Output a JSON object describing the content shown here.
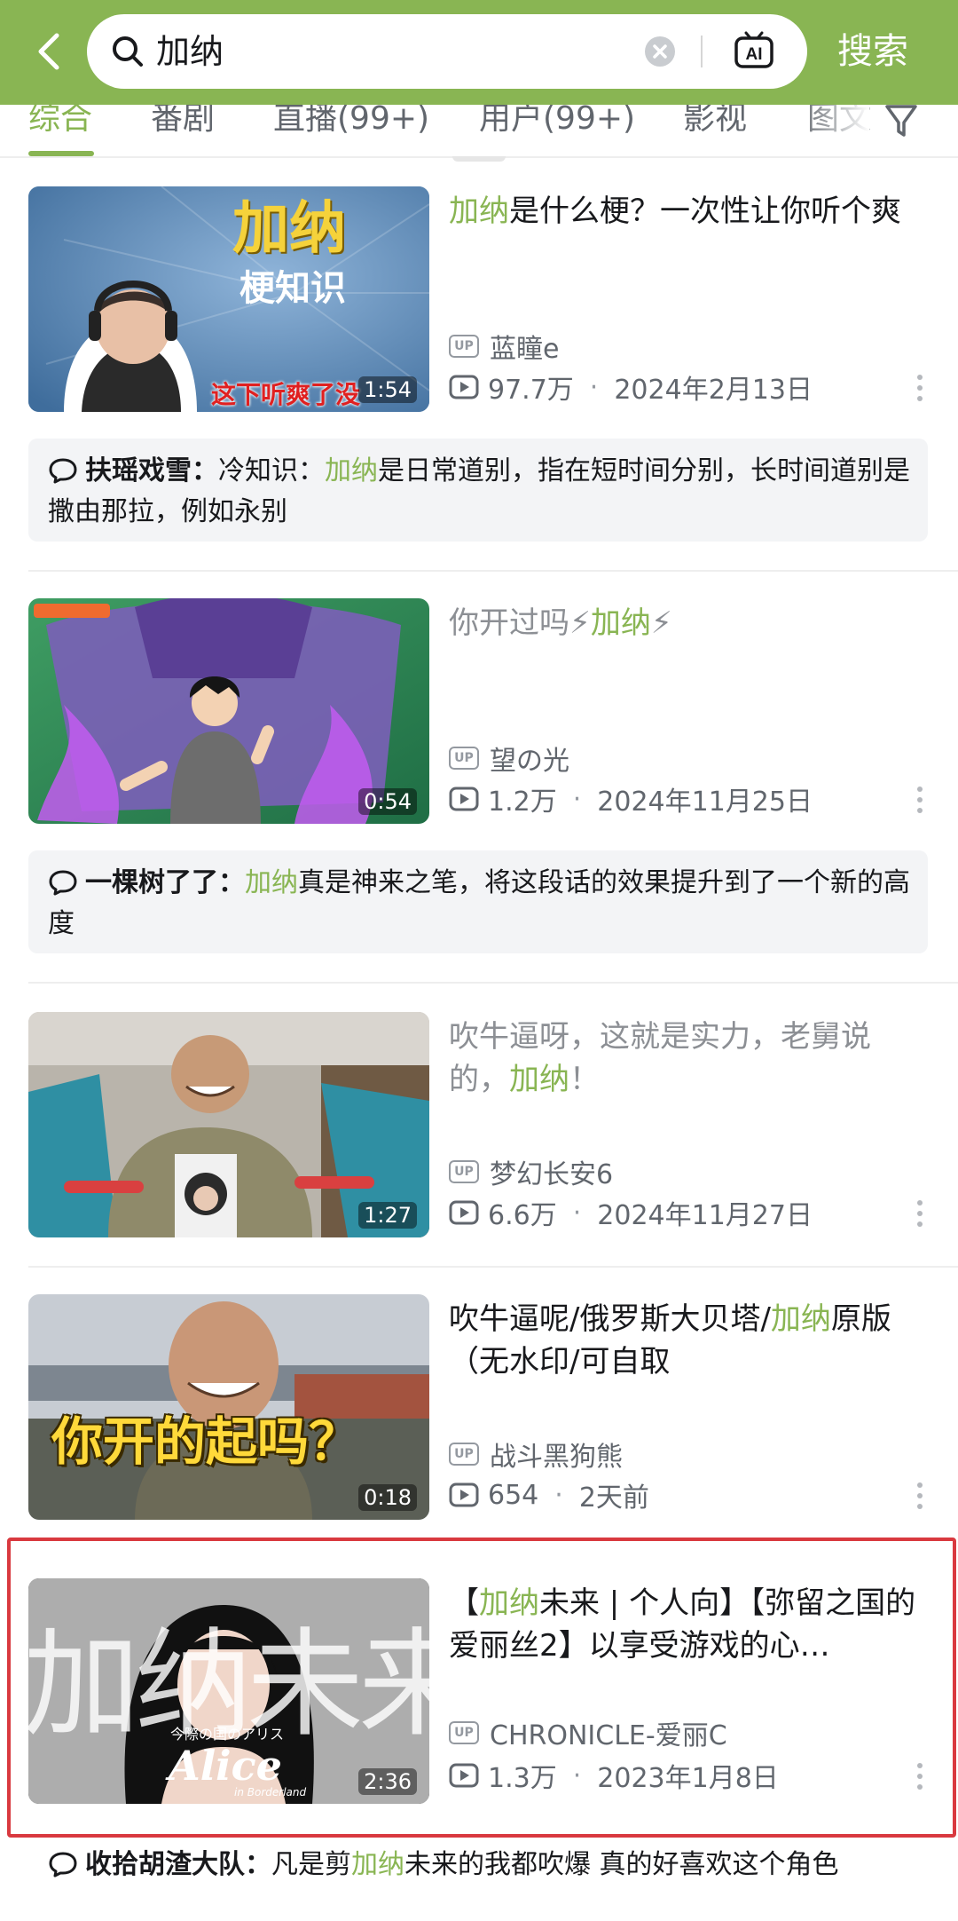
{
  "header": {
    "query": "加纳",
    "search_button": "搜索",
    "accent_color": "#89b553"
  },
  "tabs": [
    {
      "label": "综合",
      "active": true
    },
    {
      "label": "番剧",
      "active": false
    },
    {
      "label": "直播(99+)",
      "active": false
    },
    {
      "label": "用户(99+)",
      "active": false
    },
    {
      "label": "影视",
      "active": false
    },
    {
      "label": "图文",
      "active": false
    }
  ],
  "videos": [
    {
      "title_pre": "",
      "title_hl": "加纳",
      "title_post": "是什么梗？一次性让你听个爽",
      "thumb_text_1": "加纳",
      "thumb_text_2": "梗知识",
      "thumb_caption": "这下听爽了没",
      "duration": "1:54",
      "uploader": "蓝瞳e",
      "views": "97.7万",
      "date": "2024年2月13日",
      "comment": {
        "user": "扶瑶戏雪：",
        "pre": "冷知识：",
        "hl": "加纳",
        "post": "是日常道别，指在短时间分别，长时间道别是撒由那拉，例如永别"
      }
    },
    {
      "title_pre": "你开过吗⚡",
      "title_hl": "加纳",
      "title_post": "⚡",
      "duration": "0:54",
      "uploader": "望の光",
      "views": "1.2万",
      "date": "2024年11月25日",
      "comment": {
        "user": "一棵树了了：",
        "pre": "",
        "hl": "加纳",
        "post": "真是神来之笔，将这段话的效果提升到了一个新的高度"
      }
    },
    {
      "title_pre": "吹牛逼呀，这就是实力，老舅说的，",
      "title_hl": "加纳",
      "title_post": "！",
      "duration": "1:27",
      "uploader": "梦幻长安6",
      "views": "6.6万",
      "date": "2024年11月27日"
    },
    {
      "title_pre": "吹牛逼呢/俄罗斯大贝塔/",
      "title_hl": "加纳",
      "title_post": "原版（无水印/可自取",
      "thumb_caption": "你开的起吗？",
      "duration": "0:18",
      "uploader": "战斗黑狗熊",
      "views": "654",
      "date": "2天前"
    },
    {
      "title_pre": "【",
      "title_hl": "加纳",
      "title_post": "未来 | 个人向】【弥留之国的爱丽丝2】以享受游戏的心…",
      "thumb_big": "加纳未来",
      "thumb_small": "今際の国のアリス",
      "thumb_alice": "Alice",
      "thumb_sub": "in Borderland",
      "duration": "2:36",
      "uploader": "CHRONICLE-爱丽C",
      "views": "1.3万",
      "date": "2023年1月8日",
      "comment": {
        "user": "收拾胡渣大队：",
        "pre": "凡是剪",
        "hl": "加纳",
        "post": "未来的我都吹爆 真的好喜欢这个角色"
      }
    }
  ]
}
